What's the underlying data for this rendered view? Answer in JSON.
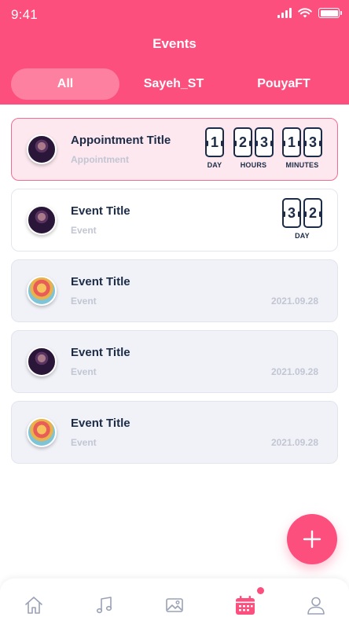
{
  "status_bar": {
    "time": "9:41"
  },
  "header": {
    "title": "Events"
  },
  "tabs": [
    {
      "label": "All",
      "active": true
    },
    {
      "label": "Sayeh_ST",
      "active": false
    },
    {
      "label": "PouyaFT",
      "active": false
    }
  ],
  "events": [
    {
      "title": "Appointment Title",
      "subtitle": "Appointment",
      "style": "highlight",
      "avatar": "dark",
      "countdown": [
        {
          "digits": [
            "1"
          ],
          "unit": "DAY"
        },
        {
          "digits": [
            "2",
            "3"
          ],
          "unit": "HOURS"
        },
        {
          "digits": [
            "1",
            "3"
          ],
          "unit": "MINUTES"
        }
      ]
    },
    {
      "title": "Event Title",
      "subtitle": "Event",
      "style": "default",
      "avatar": "dark",
      "countdown": [
        {
          "digits": [
            "3",
            "2"
          ],
          "unit": "DAY"
        }
      ]
    },
    {
      "title": "Event Title",
      "subtitle": "Event",
      "date": "2021.09.28",
      "style": "muted",
      "avatar": "bright"
    },
    {
      "title": "Event Title",
      "subtitle": "Event",
      "date": "2021.09.28",
      "style": "muted",
      "avatar": "dark"
    },
    {
      "title": "Event Title",
      "subtitle": "Event",
      "date": "2021.09.28",
      "style": "muted",
      "avatar": "bright"
    }
  ],
  "fab": {
    "icon": "plus-icon"
  },
  "bottom_nav": [
    {
      "icon": "home-icon",
      "active": false
    },
    {
      "icon": "music-icon",
      "active": false
    },
    {
      "icon": "gallery-icon",
      "active": false
    },
    {
      "icon": "calendar-icon",
      "active": true,
      "badge": true
    },
    {
      "icon": "profile-icon",
      "active": false
    }
  ],
  "colors": {
    "accent": "#fd4f7d",
    "text_dark": "#1c2c47",
    "text_muted": "#c2c6d3",
    "nav_inactive": "#9aa2b6"
  }
}
